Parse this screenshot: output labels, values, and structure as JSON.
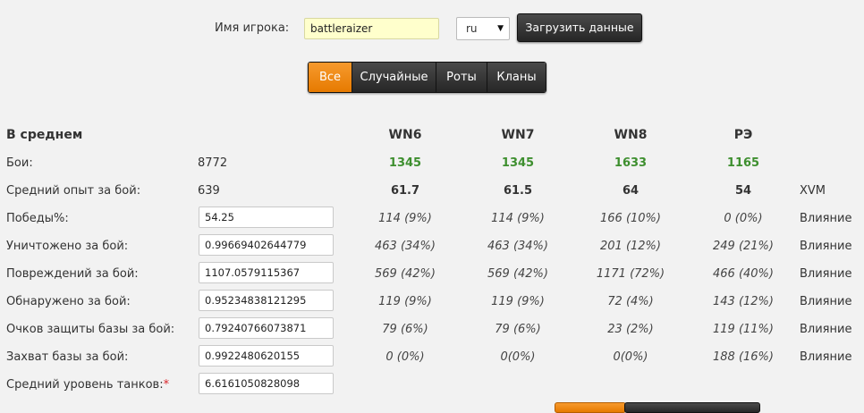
{
  "header": {
    "player_label": "Имя игрока:",
    "player_value": "battleraizer",
    "region": "ru",
    "load_button": "Загрузить данные"
  },
  "tabs": [
    {
      "label": "Все",
      "active": true
    },
    {
      "label": "Случайные",
      "active": false
    },
    {
      "label": "Роты",
      "active": false
    },
    {
      "label": "Кланы",
      "active": false
    }
  ],
  "table": {
    "title": "В среднем",
    "columns": [
      "WN6",
      "WN7",
      "WN8",
      "РЭ"
    ],
    "battles": {
      "label": "Бои:",
      "value": "8772",
      "ratings": [
        "1345",
        "1345",
        "1633",
        "1165"
      ]
    },
    "avg_exp": {
      "label": "Средний опыт за бой:",
      "value": "639",
      "ratings": [
        "61.7",
        "61.5",
        "64",
        "54"
      ],
      "suffix": "XVM"
    },
    "rows": [
      {
        "label": "Победы%:",
        "value": "54.25",
        "cols": [
          "114 (9%)",
          "114 (9%)",
          "166 (10%)",
          "0 (0%)"
        ],
        "suffix": "Влияние"
      },
      {
        "label": "Уничтожено за бой:",
        "value": "0.99669402644779",
        "cols": [
          "463 (34%)",
          "463 (34%)",
          "201 (12%)",
          "249 (21%)"
        ],
        "suffix": "Влияние"
      },
      {
        "label": "Повреждений за бой:",
        "value": "1107.0579115367",
        "cols": [
          "569 (42%)",
          "569 (42%)",
          "1171 (72%)",
          "466 (40%)"
        ],
        "suffix": "Влияние"
      },
      {
        "label": "Обнаружено за бой:",
        "value": "0.95234838121295",
        "cols": [
          "119 (9%)",
          "119 (9%)",
          "72 (4%)",
          "143 (12%)"
        ],
        "suffix": "Влияние"
      },
      {
        "label": "Очков защиты базы за бой:",
        "value": "0.79240766073871",
        "cols": [
          "79 (6%)",
          "79 (6%)",
          "23 (2%)",
          "119 (11%)"
        ],
        "suffix": "Влияние"
      },
      {
        "label": "Захват базы за бой:",
        "value": "0.9922480620155",
        "cols": [
          "0 (0%)",
          "0(0%)",
          "0(0%)",
          "188 (16%)"
        ],
        "suffix": "Влияние"
      }
    ],
    "tank_level": {
      "label": "Средний уровень танков:",
      "required_mark": "*",
      "value": "6.6161050828098"
    }
  },
  "colors": {
    "accent": "#f08a10",
    "rating_green": "#3e8f2f",
    "dark_button": "#2e2e2e"
  }
}
